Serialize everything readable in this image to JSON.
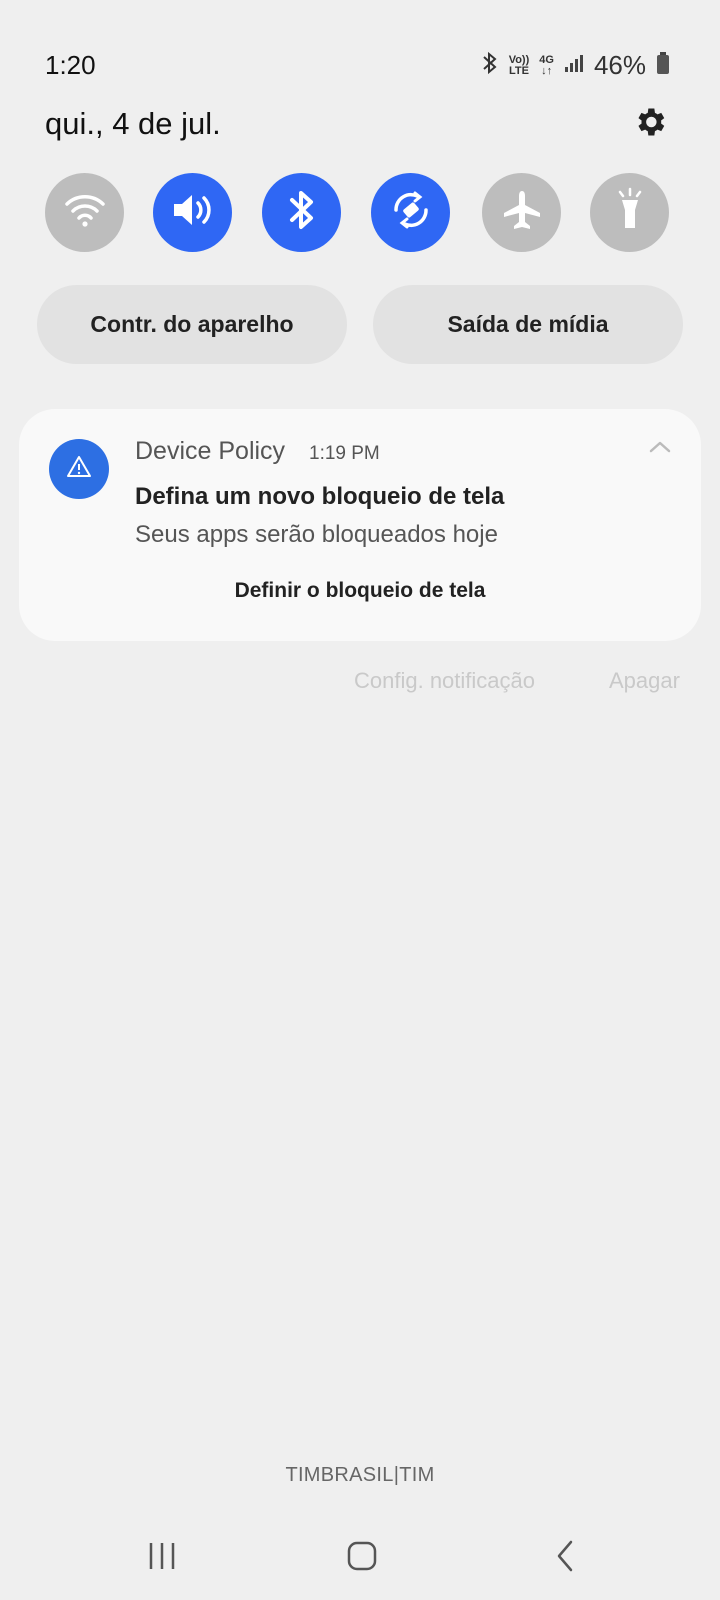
{
  "status_bar": {
    "time": "1:20",
    "battery_percent": "46%",
    "volte_label_top": "Vo))",
    "volte_label_bottom": "LTE",
    "network_label": "4G",
    "icons": [
      "bluetooth-icon",
      "volte-icon",
      "4g-data-icon",
      "signal-icon",
      "battery-icon"
    ]
  },
  "header": {
    "date": "qui., 4 de jul.",
    "settings_icon": "gear-icon"
  },
  "quick_toggles": [
    {
      "name": "wifi",
      "icon": "wifi-icon",
      "state": "off"
    },
    {
      "name": "sound",
      "icon": "speaker-icon",
      "state": "on"
    },
    {
      "name": "bluetooth",
      "icon": "bluetooth-icon",
      "state": "on"
    },
    {
      "name": "auto-rotate",
      "icon": "rotate-icon",
      "state": "on"
    },
    {
      "name": "airplane-mode",
      "icon": "airplane-icon",
      "state": "off"
    },
    {
      "name": "flashlight",
      "icon": "flashlight-icon",
      "state": "off"
    }
  ],
  "pills": {
    "device_control": "Contr. do aparelho",
    "media_output": "Saída de mídia"
  },
  "notification": {
    "app_name": "Device Policy",
    "time": "1:19 PM",
    "title": "Defina um novo bloqueio de tela",
    "text": "Seus apps serão bloqueados hoje",
    "action": "Definir o bloqueio de tela"
  },
  "notification_actions": {
    "settings": "Config. notificação",
    "clear": "Apagar"
  },
  "carrier": "TIMBRASIL|TIM",
  "colors": {
    "accent": "#2f67f4",
    "toggle_off": "#bdbdbd",
    "background": "#efefef"
  }
}
